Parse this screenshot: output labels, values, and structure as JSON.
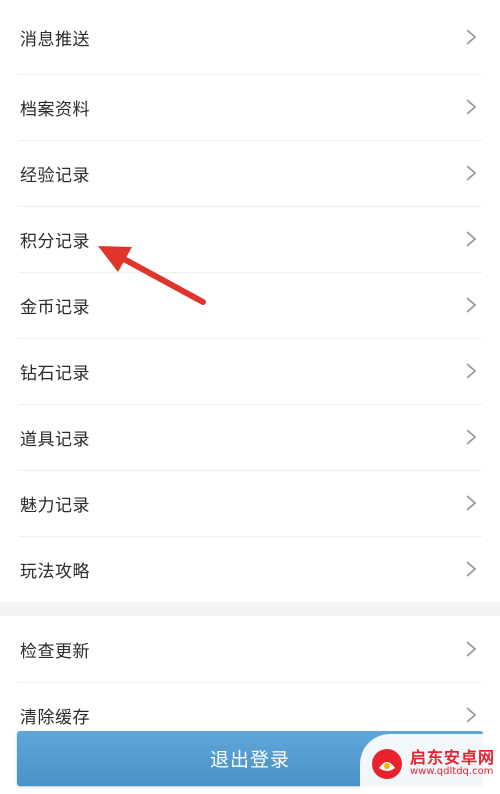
{
  "menu_primary": {
    "items": [
      {
        "label": "消息推送"
      },
      {
        "label": "档案资料"
      },
      {
        "label": "经验记录"
      },
      {
        "label": "积分记录"
      },
      {
        "label": "金币记录"
      },
      {
        "label": "钻石记录"
      },
      {
        "label": "道具记录"
      },
      {
        "label": "魅力记录"
      },
      {
        "label": "玩法攻略"
      }
    ]
  },
  "menu_secondary": {
    "items": [
      {
        "label": "检查更新"
      },
      {
        "label": "清除缓存"
      }
    ]
  },
  "logout": {
    "label": "退出登录"
  },
  "watermark": {
    "title": "启东安卓网",
    "url": "www.qdltdq.com"
  },
  "colors": {
    "logout_bg": "#4a91c8",
    "arrow": "#e0352b",
    "watermark": "#e8232b"
  },
  "icons": {
    "row_chevron": "chevron-right-icon",
    "annotation": "red-arrow-icon"
  }
}
